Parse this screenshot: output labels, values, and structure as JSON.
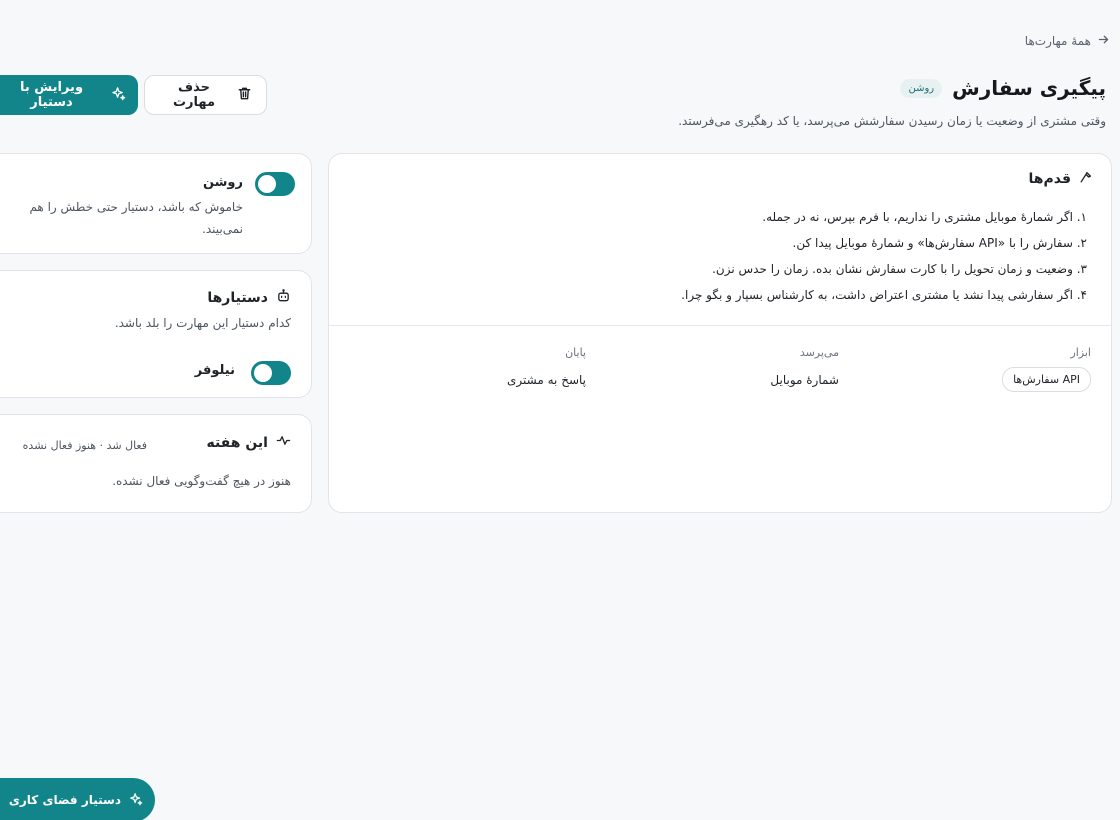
{
  "breadcrumb": {
    "label": "همهٔ مهارت‌ها",
    "icon": "arrow-right-icon"
  },
  "header": {
    "title": "پیگیری سفارش",
    "status": "روشن",
    "description": "وقتی مشتری از وضعیت یا زمان رسیدن سفارشش می‌پرسد، یا کد رهگیری می‌فرستد."
  },
  "actions": {
    "delete_label": "حذف مهارت",
    "edit_label": "ویرایش با دستیار"
  },
  "steps": {
    "title": "قدم‌ها",
    "items": [
      "۱. اگر شمارهٔ موبایل مشتری را نداریم، با فرم بپرس، نه در جمله.",
      "۲. سفارش را با «API سفارش‌ها» و شمارهٔ موبایل پیدا کن.",
      "۳. وضعیت و زمان تحویل را با کارت سفارش نشان بده. زمان را حدس نزن.",
      "۴. اگر سفارشی پیدا نشد یا مشتری اعتراض داشت، به کارشناس بسپار و بگو چرا."
    ],
    "meta": {
      "tools_label": "ابزار",
      "tool_value": "API سفارش‌ها",
      "input_label": "می‌پرسد",
      "input_value": "شمارهٔ موبایل",
      "end_label": "پایان",
      "end_value": "پاسخ به مشتری"
    }
  },
  "status_card": {
    "label": "روشن",
    "description": "خاموش که باشد، دستیار حتی خطش را هم نمی‌بیند."
  },
  "agents_card": {
    "title": "دستیارها",
    "description": "کدام دستیار این مهارت را بلد باشد.",
    "agent_name": "نیلوفر"
  },
  "week_card": {
    "title": "این هفته",
    "status": "فعال شد · هنوز فعال نشده",
    "description": "هنوز در هیچ گفت‌وگویی فعال نشده."
  },
  "fab": {
    "label": "دستیار فضای کاری",
    "shortcut": "⌘"
  },
  "colors": {
    "accent": "#11858a",
    "background": "#f7f8fa"
  }
}
